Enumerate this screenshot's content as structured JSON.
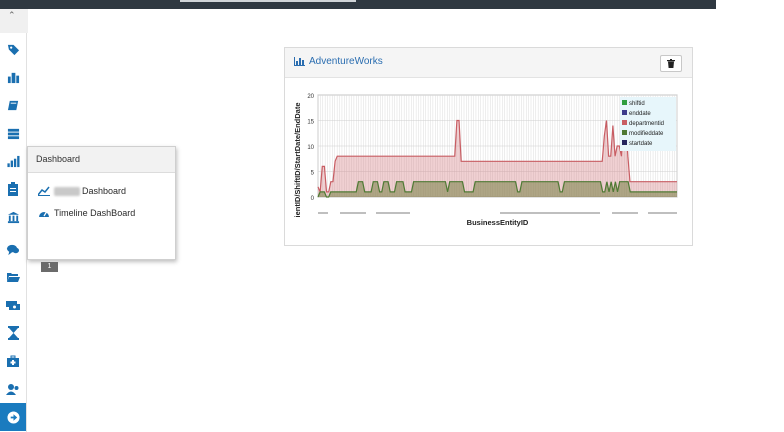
{
  "topbar": {
    "corner_glyph": "⌃"
  },
  "sidebar": {
    "items": [
      {
        "name": "tag-icon"
      },
      {
        "name": "buildings-icon"
      },
      {
        "name": "book-icon"
      },
      {
        "name": "layers-icon"
      },
      {
        "name": "bar-chart-icon"
      },
      {
        "name": "clipboard-icon"
      },
      {
        "name": "bank-icon"
      },
      {
        "name": "comments-icon"
      },
      {
        "name": "folder-open-icon"
      },
      {
        "name": "cash-icon"
      },
      {
        "name": "hourglass-icon"
      },
      {
        "name": "medkit-icon"
      },
      {
        "name": "users-icon"
      },
      {
        "name": "arrow-circle-right-icon"
      }
    ]
  },
  "flyout": {
    "header": "Dashboard",
    "items": [
      {
        "label": "Dashboard",
        "icon": "line-chart-icon"
      },
      {
        "label": "Timeline DashBoard",
        "icon": "dashboard-gauge-icon"
      }
    ]
  },
  "pager": {
    "current": "1"
  },
  "panel": {
    "title": "AdventureWorks",
    "title_icon": "bar-chart-icon",
    "delete_icon": "trash-icon"
  },
  "chart_data": {
    "type": "area",
    "xlabel": "BusinessEntityID",
    "ylabel": "ientID/ShiftID/StartDate/EndDate",
    "ylim": [
      0,
      20
    ],
    "yticks": [
      0,
      5,
      10,
      15,
      20
    ],
    "legend_placement": "top-right",
    "grid": true,
    "series": [
      {
        "name": "shiftid",
        "color": "#2e9e3e",
        "values": []
      },
      {
        "name": "enddate",
        "color": "#3c3c8c",
        "values": []
      },
      {
        "name": "departmentid",
        "color": "#c85d63",
        "values": [
          2,
          1,
          6,
          6,
          1,
          1,
          3,
          3,
          7,
          8,
          8,
          8,
          8,
          8,
          8,
          8,
          8,
          8,
          8,
          8,
          8,
          8,
          8,
          8,
          8,
          8,
          8,
          8,
          8,
          8,
          8,
          8,
          8,
          8,
          8,
          8,
          8,
          8,
          8,
          8,
          8,
          8,
          8,
          8,
          8,
          8,
          8,
          8,
          8,
          8,
          8,
          8,
          8,
          8,
          8,
          8,
          8,
          8,
          8,
          8,
          8,
          8,
          8,
          8,
          8,
          15,
          15,
          7,
          7,
          7,
          7,
          7,
          7,
          7,
          7,
          7,
          7,
          7,
          7,
          7,
          7,
          7,
          7,
          7,
          7,
          7,
          7,
          7,
          7,
          7,
          7,
          7,
          7,
          7,
          7,
          7,
          7,
          7,
          7,
          7,
          7,
          7,
          7,
          7,
          7,
          7,
          7,
          7,
          7,
          7,
          7,
          7,
          7,
          7,
          7,
          7,
          7,
          7,
          7,
          7,
          7,
          7,
          7,
          7,
          7,
          7,
          7,
          7,
          7,
          7,
          7,
          7,
          7,
          7,
          12,
          15,
          8,
          8,
          14,
          8,
          10,
          10,
          8,
          15,
          15,
          8,
          3,
          3,
          3,
          3,
          3,
          3,
          3,
          3,
          3,
          3,
          3,
          3,
          3,
          3,
          3,
          3,
          3,
          3,
          3,
          3,
          3,
          3,
          3
        ]
      },
      {
        "name": "modifieddate",
        "color": "#4f7a34",
        "values": [
          0,
          1,
          1,
          1,
          0,
          0,
          1,
          1,
          1,
          1,
          1,
          1,
          1,
          1,
          1,
          1,
          1,
          1,
          1,
          3,
          3,
          3,
          1,
          1,
          1,
          1,
          3,
          3,
          3,
          1,
          1,
          3,
          3,
          3,
          1,
          1,
          1,
          3,
          3,
          3,
          3,
          1,
          1,
          1,
          1,
          3,
          3,
          3,
          3,
          3,
          3,
          3,
          3,
          3,
          3,
          3,
          3,
          3,
          3,
          3,
          3,
          1,
          3,
          3,
          3,
          3,
          3,
          3,
          3,
          1,
          1,
          1,
          1,
          1,
          3,
          3,
          3,
          3,
          3,
          3,
          3,
          3,
          3,
          3,
          3,
          3,
          3,
          3,
          3,
          3,
          3,
          3,
          3,
          3,
          1,
          1,
          3,
          3,
          3,
          3,
          3,
          3,
          3,
          3,
          3,
          3,
          3,
          3,
          3,
          3,
          3,
          3,
          3,
          3,
          1,
          1,
          3,
          3,
          3,
          3,
          3,
          3,
          3,
          3,
          3,
          3,
          3,
          3,
          3,
          3,
          3,
          3,
          3,
          3,
          1,
          1,
          3,
          1,
          3,
          1,
          3,
          1,
          3,
          3,
          3,
          3,
          3,
          1,
          1,
          1,
          1,
          1,
          1,
          1,
          1,
          1,
          1,
          1,
          1,
          1,
          1,
          1,
          1,
          1,
          1,
          1,
          1,
          1,
          1,
          1
        ]
      },
      {
        "name": "startdate",
        "color": "#25255e",
        "values": []
      }
    ]
  }
}
